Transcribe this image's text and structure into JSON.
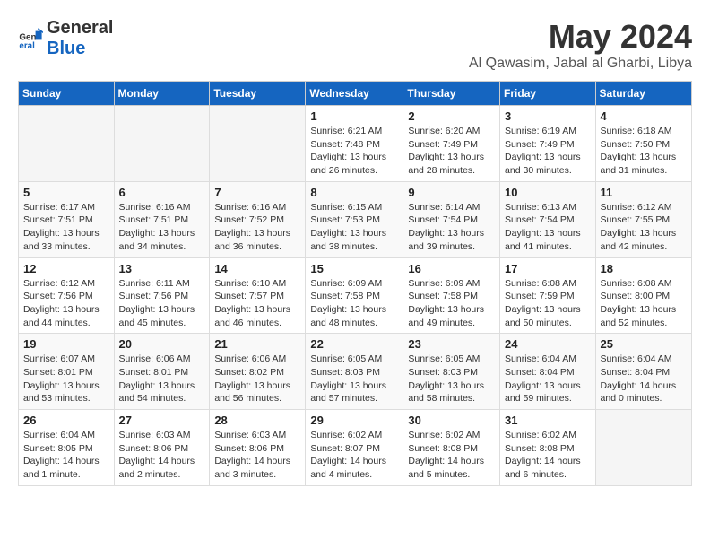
{
  "header": {
    "logo_general": "General",
    "logo_blue": "Blue",
    "title": "May 2024",
    "subtitle": "Al Qawasim, Jabal al Gharbi, Libya"
  },
  "days_of_week": [
    "Sunday",
    "Monday",
    "Tuesday",
    "Wednesday",
    "Thursday",
    "Friday",
    "Saturday"
  ],
  "weeks": [
    [
      {
        "day": "",
        "info": ""
      },
      {
        "day": "",
        "info": ""
      },
      {
        "day": "",
        "info": ""
      },
      {
        "day": "1",
        "info": "Sunrise: 6:21 AM\nSunset: 7:48 PM\nDaylight: 13 hours\nand 26 minutes."
      },
      {
        "day": "2",
        "info": "Sunrise: 6:20 AM\nSunset: 7:49 PM\nDaylight: 13 hours\nand 28 minutes."
      },
      {
        "day": "3",
        "info": "Sunrise: 6:19 AM\nSunset: 7:49 PM\nDaylight: 13 hours\nand 30 minutes."
      },
      {
        "day": "4",
        "info": "Sunrise: 6:18 AM\nSunset: 7:50 PM\nDaylight: 13 hours\nand 31 minutes."
      }
    ],
    [
      {
        "day": "5",
        "info": "Sunrise: 6:17 AM\nSunset: 7:51 PM\nDaylight: 13 hours\nand 33 minutes."
      },
      {
        "day": "6",
        "info": "Sunrise: 6:16 AM\nSunset: 7:51 PM\nDaylight: 13 hours\nand 34 minutes."
      },
      {
        "day": "7",
        "info": "Sunrise: 6:16 AM\nSunset: 7:52 PM\nDaylight: 13 hours\nand 36 minutes."
      },
      {
        "day": "8",
        "info": "Sunrise: 6:15 AM\nSunset: 7:53 PM\nDaylight: 13 hours\nand 38 minutes."
      },
      {
        "day": "9",
        "info": "Sunrise: 6:14 AM\nSunset: 7:54 PM\nDaylight: 13 hours\nand 39 minutes."
      },
      {
        "day": "10",
        "info": "Sunrise: 6:13 AM\nSunset: 7:54 PM\nDaylight: 13 hours\nand 41 minutes."
      },
      {
        "day": "11",
        "info": "Sunrise: 6:12 AM\nSunset: 7:55 PM\nDaylight: 13 hours\nand 42 minutes."
      }
    ],
    [
      {
        "day": "12",
        "info": "Sunrise: 6:12 AM\nSunset: 7:56 PM\nDaylight: 13 hours\nand 44 minutes."
      },
      {
        "day": "13",
        "info": "Sunrise: 6:11 AM\nSunset: 7:56 PM\nDaylight: 13 hours\nand 45 minutes."
      },
      {
        "day": "14",
        "info": "Sunrise: 6:10 AM\nSunset: 7:57 PM\nDaylight: 13 hours\nand 46 minutes."
      },
      {
        "day": "15",
        "info": "Sunrise: 6:09 AM\nSunset: 7:58 PM\nDaylight: 13 hours\nand 48 minutes."
      },
      {
        "day": "16",
        "info": "Sunrise: 6:09 AM\nSunset: 7:58 PM\nDaylight: 13 hours\nand 49 minutes."
      },
      {
        "day": "17",
        "info": "Sunrise: 6:08 AM\nSunset: 7:59 PM\nDaylight: 13 hours\nand 50 minutes."
      },
      {
        "day": "18",
        "info": "Sunrise: 6:08 AM\nSunset: 8:00 PM\nDaylight: 13 hours\nand 52 minutes."
      }
    ],
    [
      {
        "day": "19",
        "info": "Sunrise: 6:07 AM\nSunset: 8:01 PM\nDaylight: 13 hours\nand 53 minutes."
      },
      {
        "day": "20",
        "info": "Sunrise: 6:06 AM\nSunset: 8:01 PM\nDaylight: 13 hours\nand 54 minutes."
      },
      {
        "day": "21",
        "info": "Sunrise: 6:06 AM\nSunset: 8:02 PM\nDaylight: 13 hours\nand 56 minutes."
      },
      {
        "day": "22",
        "info": "Sunrise: 6:05 AM\nSunset: 8:03 PM\nDaylight: 13 hours\nand 57 minutes."
      },
      {
        "day": "23",
        "info": "Sunrise: 6:05 AM\nSunset: 8:03 PM\nDaylight: 13 hours\nand 58 minutes."
      },
      {
        "day": "24",
        "info": "Sunrise: 6:04 AM\nSunset: 8:04 PM\nDaylight: 13 hours\nand 59 minutes."
      },
      {
        "day": "25",
        "info": "Sunrise: 6:04 AM\nSunset: 8:04 PM\nDaylight: 14 hours\nand 0 minutes."
      }
    ],
    [
      {
        "day": "26",
        "info": "Sunrise: 6:04 AM\nSunset: 8:05 PM\nDaylight: 14 hours\nand 1 minute."
      },
      {
        "day": "27",
        "info": "Sunrise: 6:03 AM\nSunset: 8:06 PM\nDaylight: 14 hours\nand 2 minutes."
      },
      {
        "day": "28",
        "info": "Sunrise: 6:03 AM\nSunset: 8:06 PM\nDaylight: 14 hours\nand 3 minutes."
      },
      {
        "day": "29",
        "info": "Sunrise: 6:02 AM\nSunset: 8:07 PM\nDaylight: 14 hours\nand 4 minutes."
      },
      {
        "day": "30",
        "info": "Sunrise: 6:02 AM\nSunset: 8:08 PM\nDaylight: 14 hours\nand 5 minutes."
      },
      {
        "day": "31",
        "info": "Sunrise: 6:02 AM\nSunset: 8:08 PM\nDaylight: 14 hours\nand 6 minutes."
      },
      {
        "day": "",
        "info": ""
      }
    ]
  ]
}
